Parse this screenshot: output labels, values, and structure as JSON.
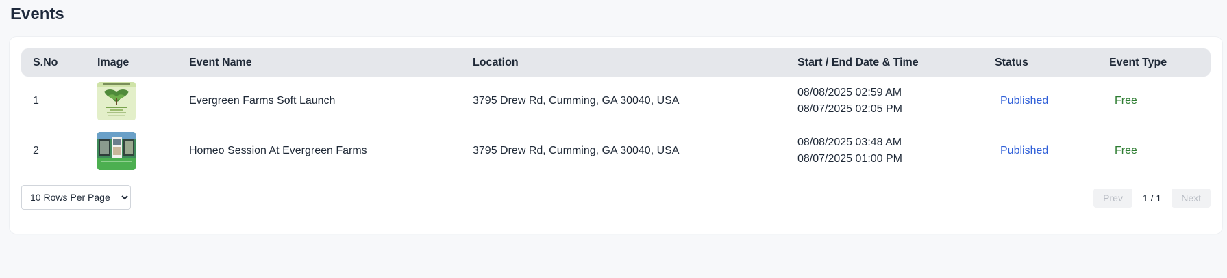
{
  "page": {
    "title": "Events"
  },
  "table": {
    "headers": [
      "S.No",
      "Image",
      "Event Name",
      "Location",
      "Start / End Date & Time",
      "Status",
      "Event Type"
    ],
    "rows": [
      {
        "sno": "1",
        "image": "event-flyer-thumbnail",
        "name": "Evergreen Farms Soft Launch",
        "location": "3795 Drew Rd, Cumming, GA 30040, USA",
        "start": "08/08/2025 02:59 AM",
        "end": "08/07/2025 02:05 PM",
        "status": "Published",
        "type": "Free"
      },
      {
        "sno": "2",
        "image": "event-photo-collage-thumbnail",
        "name": "Homeo Session At Evergreen Farms",
        "location": "3795 Drew Rd, Cumming, GA 30040, USA",
        "start": "08/08/2025 03:48 AM",
        "end": "08/07/2025 01:00 PM",
        "status": "Published",
        "type": "Free"
      }
    ]
  },
  "pagination": {
    "rows_per_page": "10 Rows Per Page",
    "prev_label": "Prev",
    "next_label": "Next",
    "page_info": "1 / 1"
  },
  "colors": {
    "status_published": "#2f5fd8",
    "type_free": "#2e7d32",
    "header_bg": "#e5e7eb"
  }
}
